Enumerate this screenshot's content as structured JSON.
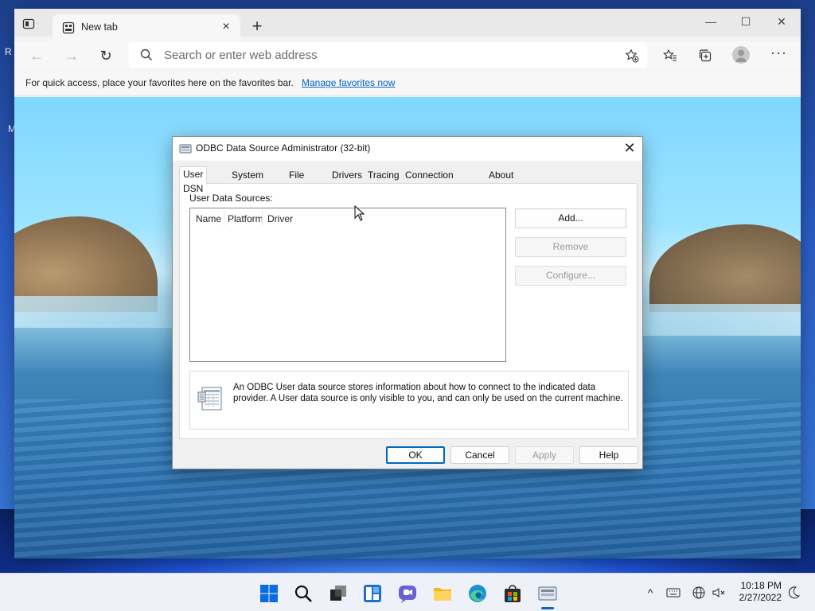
{
  "desktop": {
    "edge_text_1": "R",
    "edge_text_2": "M"
  },
  "browser": {
    "tab": {
      "title": "New tab"
    },
    "address": {
      "placeholder": "Search or enter web address"
    },
    "favorites_bar": {
      "message": "For quick access, place your favorites here on the favorites bar.",
      "link": "Manage favorites now"
    },
    "icons": [
      "tab-actions-icon",
      "new-tab-page-icon",
      "close-tab-icon",
      "new-tab-icon",
      "back-icon",
      "forward-icon",
      "refresh-icon",
      "search-icon",
      "add-favorite-icon",
      "favorites-icon",
      "collections-icon",
      "profile-icon",
      "more-icon",
      "minimize-icon",
      "maximize-icon",
      "close-window-icon"
    ]
  },
  "dialog": {
    "title": "ODBC Data Source Administrator (32-bit)",
    "tabs": [
      "User DSN",
      "System DSN",
      "File DSN",
      "Drivers",
      "Tracing",
      "Connection Pooling",
      "About"
    ],
    "active_tab": "User DSN",
    "panel_label": "User Data Sources:",
    "columns": [
      "Name",
      "Platform",
      "Driver"
    ],
    "rows": [],
    "side_buttons": {
      "add": "Add...",
      "remove": "Remove",
      "configure": "Configure..."
    },
    "info_text": "An ODBC User data source stores information about how to connect to the indicated data provider.   A User data source is only visible to you, and can only be used on the current machine.",
    "footer_buttons": {
      "ok": "OK",
      "cancel": "Cancel",
      "apply": "Apply",
      "help": "Help"
    }
  },
  "taskbar": {
    "apps": [
      "start",
      "search",
      "task-view",
      "widgets",
      "chat",
      "file-explorer",
      "edge",
      "store",
      "odbc-admin"
    ],
    "clock": {
      "time": "10:18 PM",
      "date": "2/27/2022"
    }
  },
  "colors": {
    "accent": "#0067c0",
    "link": "#0a60c2",
    "taskbar": "#eef1f7"
  }
}
